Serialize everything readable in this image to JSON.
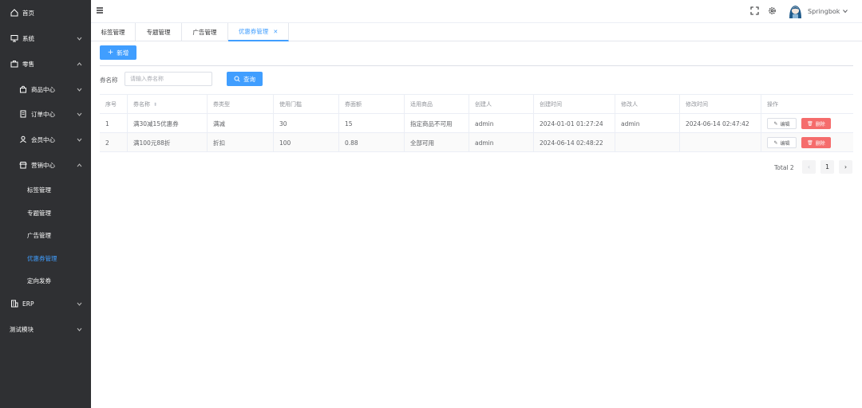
{
  "sidebar": {
    "home": "首页",
    "system": "系统",
    "retail": "零售",
    "goods_center": "商品中心",
    "order_center": "订单中心",
    "member_center": "会员中心",
    "marketing_center": "营销中心",
    "tag_mgmt": "标签管理",
    "topic_mgmt": "专题管理",
    "ad_mgmt": "广告管理",
    "coupon_mgmt": "优惠券管理",
    "targeted_coupon": "定向发券",
    "erp": "ERP",
    "test_module": "测试模块"
  },
  "header": {
    "username": "Springbok"
  },
  "tabs": [
    "标签管理",
    "专题管理",
    "广告管理",
    "优惠券管理"
  ],
  "toolbar": {
    "new_label": "新增",
    "search_label": "券名称",
    "search_placeholder": "请输入券名称",
    "query_label": "查询"
  },
  "table": {
    "columns": [
      "序号",
      "券名称",
      "券类型",
      "使用门槛",
      "券面额",
      "适用商品",
      "创建人",
      "创建时间",
      "修改人",
      "修改时间",
      "操作"
    ],
    "rows": [
      [
        "1",
        "满30减15优惠券",
        "满减",
        "30",
        "15",
        "指定商品不可用",
        "admin",
        "2024-01-01 01:27:24",
        "admin",
        "2024-06-14 02:47:42"
      ],
      [
        "2",
        "满100元88折",
        "折扣",
        "100",
        "0.88",
        "全部可用",
        "admin",
        "2024-06-14 02:48:22",
        "",
        ""
      ]
    ],
    "edit_label": "编辑",
    "delete_label": "删除"
  },
  "pagination": {
    "total": "Total 2",
    "current_page": "1"
  },
  "colors": {
    "sidebar_bg": "#2f3033",
    "accent": "#409eff",
    "danger": "#f56c6c"
  }
}
